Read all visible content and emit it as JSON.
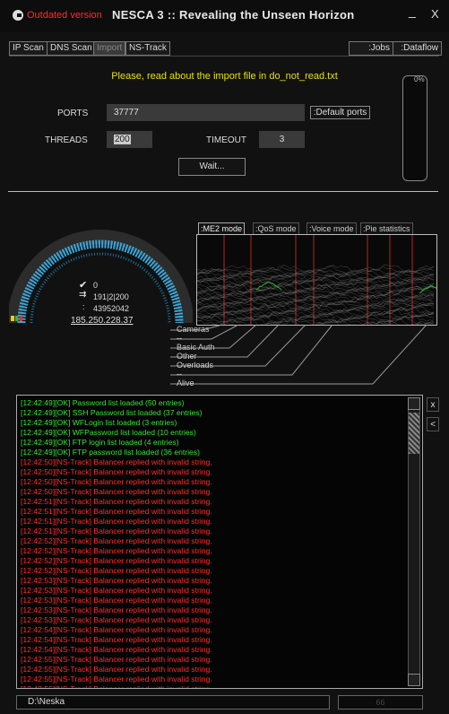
{
  "window": {
    "outdated_label": "Outdated version",
    "title": "NESCA 3 :: Revealing the Unseen Horizon",
    "minimize": "_",
    "close": "X"
  },
  "tabs": [
    "IP Scan",
    "DNS Scan",
    "Import",
    "NS-Track"
  ],
  "active_tab": "Import",
  "right_buttons": [
    ":Jobs",
    ":Dataflow"
  ],
  "import_note": "Please, read about the import file in do_not_read.txt",
  "form": {
    "ports_label": "PORTS",
    "ports_value": "37777",
    "default_ports_button": ":Default ports",
    "threads_label": "THREADS",
    "threads_value": "200",
    "timeout_label": "TIMEOUT",
    "timeout_value": "3",
    "wait_button": "Wait..."
  },
  "progress_label": "0%",
  "gauge": {
    "found": "0",
    "threads": "191|2|200",
    "counter": "43952042",
    "current_ip": "185.250.228.37"
  },
  "mode_tabs": [
    ":ME2 mode",
    ":QoS mode",
    ":Voice mode",
    ":Pie statistics"
  ],
  "legend": [
    "Cameras",
    "--",
    "Basic Auth",
    "Other",
    "Overloads",
    "--",
    "Alive"
  ],
  "log": [
    {
      "text": "[12:42:49][OK] Password list loaded (50 entries)",
      "color": "#31e531"
    },
    {
      "text": "[12:42:49][OK] SSH Password list loaded (37 entries)",
      "color": "#31e531"
    },
    {
      "text": "[12:42:49][OK] WFLogin list loaded (3 entries)",
      "color": "#31e531"
    },
    {
      "text": "[12:42:49][OK] WFPassword list loaded (10 entries)",
      "color": "#31e531"
    },
    {
      "text": "[12:42:49][OK] FTP login list loaded (4 entries)",
      "color": "#31e531"
    },
    {
      "text": "[12:42:49][OK] FTP password list loaded (36 entries)",
      "color": "#31e531"
    },
    {
      "text": "[12:42:50][NS-Track] Balancer replied with invalid string.",
      "color": "#ff2b2b"
    },
    {
      "text": "[12:42:50][NS-Track] Balancer replied with invalid string.",
      "color": "#ff2b2b"
    },
    {
      "text": "[12:42:50][NS-Track] Balancer replied with invalid string.",
      "color": "#ff2b2b"
    },
    {
      "text": "[12:42:50][NS-Track] Balancer replied with invalid string.",
      "color": "#ff2b2b"
    },
    {
      "text": "[12:42:51][NS-Track] Balancer replied with invalid string.",
      "color": "#ff2b2b"
    },
    {
      "text": "[12:42:51][NS-Track] Balancer replied with invalid string.",
      "color": "#ff2b2b"
    },
    {
      "text": "[12:42:51][NS-Track] Balancer replied with invalid string.",
      "color": "#ff2b2b"
    },
    {
      "text": "[12:42:51][NS-Track] Balancer replied with invalid string.",
      "color": "#ff2b2b"
    },
    {
      "text": "[12:42:52][NS-Track] Balancer replied with invalid string.",
      "color": "#ff2b2b"
    },
    {
      "text": "[12:42:52][NS-Track] Balancer replied with invalid string.",
      "color": "#ff2b2b"
    },
    {
      "text": "[12:42:52][NS-Track] Balancer replied with invalid string.",
      "color": "#ff2b2b"
    },
    {
      "text": "[12:42:52][NS-Track] Balancer replied with invalid string.",
      "color": "#ff2b2b"
    },
    {
      "text": "[12:42:53][NS-Track] Balancer replied with invalid string.",
      "color": "#ff2b2b"
    },
    {
      "text": "[12:42:53][NS-Track] Balancer replied with invalid string.",
      "color": "#ff2b2b"
    },
    {
      "text": "[12:42:53][NS-Track] Balancer replied with invalid string.",
      "color": "#ff2b2b"
    },
    {
      "text": "[12:42:53][NS-Track] Balancer replied with invalid string.",
      "color": "#ff2b2b"
    },
    {
      "text": "[12:42:53][NS-Track] Balancer replied with invalid string.",
      "color": "#ff2b2b"
    },
    {
      "text": "[12:42:54][NS-Track] Balancer replied with invalid string.",
      "color": "#ff2b2b"
    },
    {
      "text": "[12:42:54][NS-Track] Balancer replied with invalid string.",
      "color": "#ff2b2b"
    },
    {
      "text": "[12:42:54][NS-Track] Balancer replied with invalid string.",
      "color": "#ff2b2b"
    },
    {
      "text": "[12:42:55][NS-Track] Balancer replied with invalid string.",
      "color": "#ff2b2b"
    },
    {
      "text": "[12:42:55][NS-Track] Balancer replied with invalid string.",
      "color": "#ff2b2b"
    },
    {
      "text": "[12:42:55][NS-Track] Balancer replied with invalid string.",
      "color": "#ff2b2b"
    },
    {
      "text": "[12:42:56][NS-Track] Balancer replied with invalid string.",
      "color": "#ff2b2b"
    },
    {
      "text": "[12:42:56][NS-Track] Balancer replied with invalid string.",
      "color": "#ff2b2b"
    },
    {
      "text": "[12:42:56][NS-Track] Balancer replied with invalid string.",
      "color": "#ff2b2b"
    }
  ],
  "side_buttons": [
    "x",
    "<"
  ],
  "status": {
    "path": "D:\\Neska",
    "progress_text": "66"
  }
}
